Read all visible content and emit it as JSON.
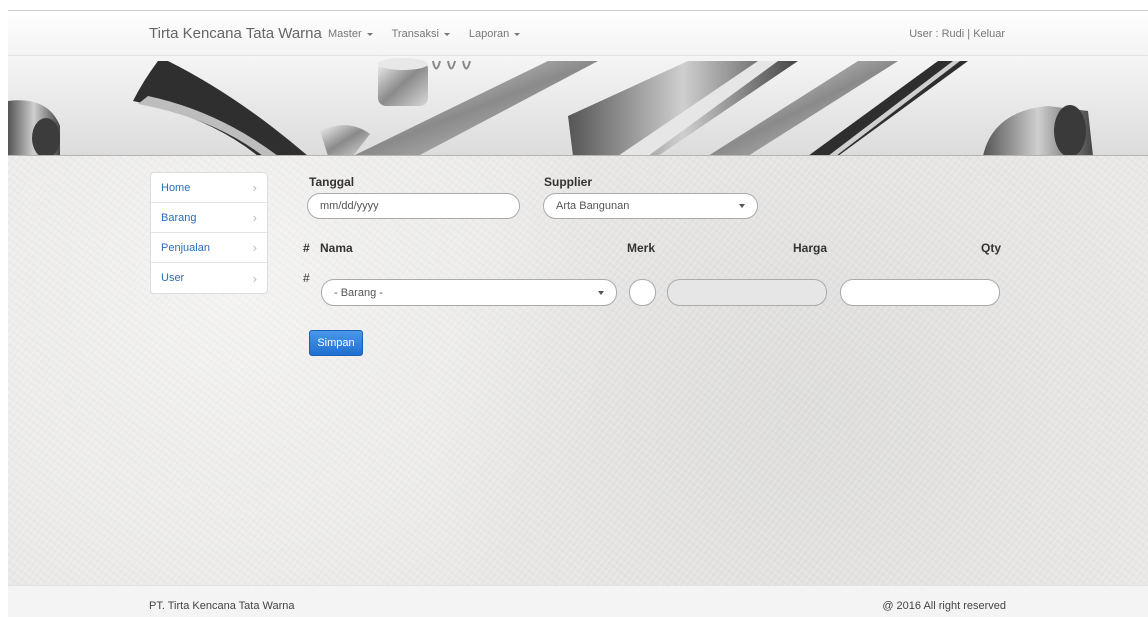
{
  "navbar": {
    "brand": "Tirta Kencana Tata Warna",
    "menu": [
      {
        "label": "Master"
      },
      {
        "label": "Transaksi"
      },
      {
        "label": "Laporan"
      }
    ],
    "user_text": "User : Rudi",
    "separator": " | ",
    "logout": "Keluar"
  },
  "sidebar": {
    "items": [
      {
        "label": "Home"
      },
      {
        "label": "Barang"
      },
      {
        "label": "Penjualan"
      },
      {
        "label": "User"
      }
    ]
  },
  "form": {
    "date_label": "Tanggal",
    "date_placeholder": "mm/dd/yyyy",
    "supplier_label": "Supplier",
    "supplier_value": "Arta Bangunan",
    "table_headers": {
      "num": "#",
      "nama": "Nama",
      "merk": "Merk",
      "harga": "Harga",
      "qty": "Qty"
    },
    "row": {
      "num": "#",
      "barang_value": "- Barang -",
      "merk_value": "",
      "harga_value": "",
      "qty_value": ""
    },
    "submit_label": "Simpan"
  },
  "footer": {
    "company": "PT. Tirta Kencana Tata Warna",
    "copyright": "@ 2016 All right reserved"
  },
  "colors": {
    "link": "#2a6ebb",
    "primary_button": "#2a7ee0"
  }
}
